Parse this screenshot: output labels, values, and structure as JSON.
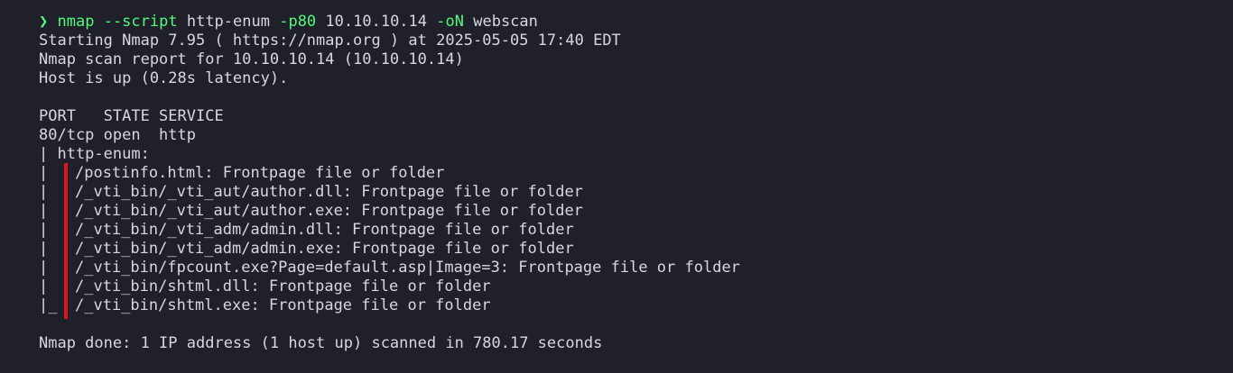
{
  "prompt": {
    "symbol": "❯",
    "command": "nmap",
    "flag1": "--script",
    "arg1": "http-enum",
    "flag2": "-p80",
    "target": "10.10.10.14",
    "flag3": "-oN",
    "outfile": "webscan"
  },
  "output": {
    "starting": "Starting Nmap 7.95 ( https://nmap.org ) at 2025-05-05 17:40 EDT",
    "report": "Nmap scan report for 10.10.10.14 (10.10.10.14)",
    "host_up": "Host is up (0.28s latency).",
    "table_header": "PORT   STATE SERVICE",
    "port_row": "80/tcp open  http",
    "script_name": "| http-enum:",
    "enum_prefix": "|",
    "enum_last_prefix": "|_",
    "enum_items": [
      "/postinfo.html: Frontpage file or folder",
      "/_vti_bin/_vti_aut/author.dll: Frontpage file or folder",
      "/_vti_bin/_vti_aut/author.exe: Frontpage file or folder",
      "/_vti_bin/_vti_adm/admin.dll: Frontpage file or folder",
      "/_vti_bin/_vti_adm/admin.exe: Frontpage file or folder",
      "/_vti_bin/fpcount.exe?Page=default.asp|Image=3: Frontpage file or folder",
      "/_vti_bin/shtml.dll: Frontpage file or folder",
      "/_vti_bin/shtml.exe: Frontpage file or folder"
    ],
    "done": "Nmap done: 1 IP address (1 host up) scanned in 780.17 seconds"
  },
  "colors": {
    "background": "#1f2029",
    "text": "#d7d8df",
    "command": "#50fa7b",
    "highlight_bar": "#e0131a"
  }
}
